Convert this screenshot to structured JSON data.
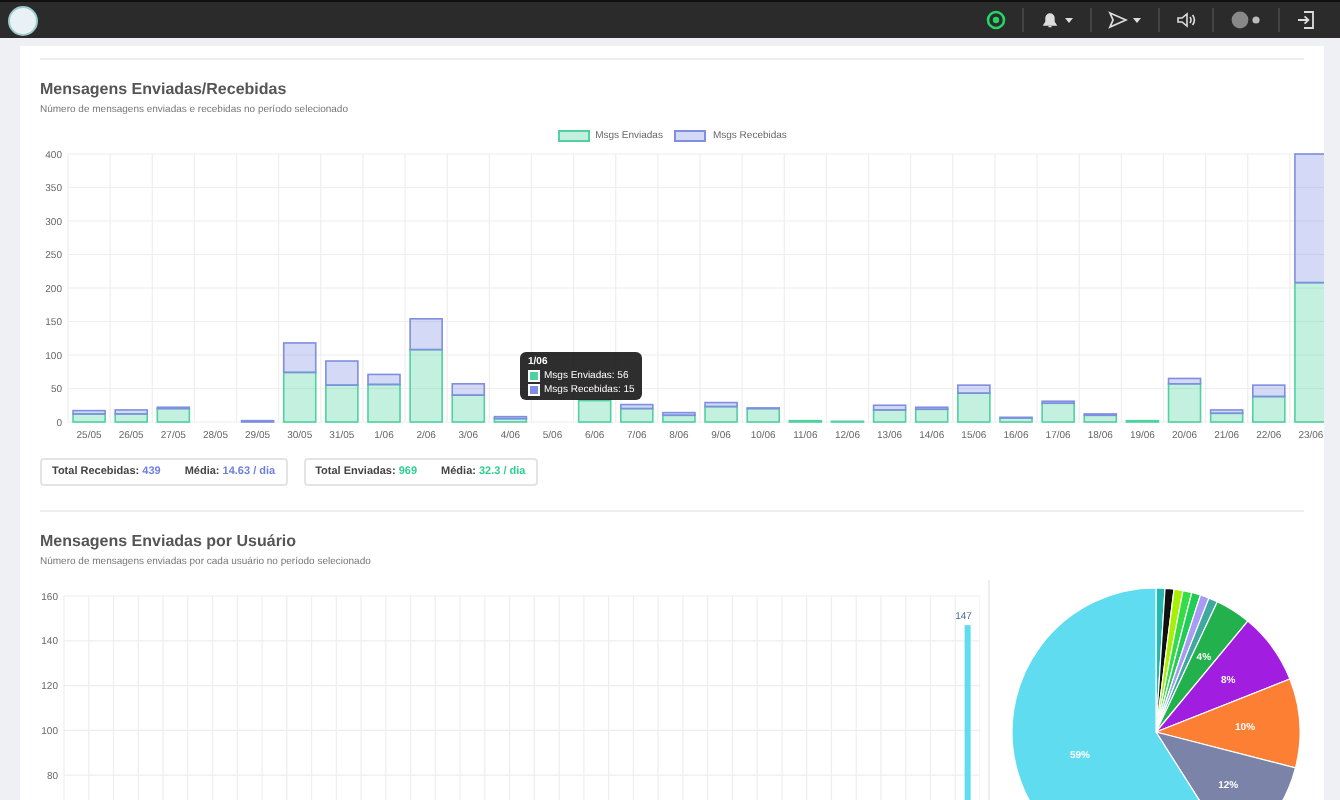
{
  "navbar": {
    "items": [
      {
        "kind": "whatsapp"
      },
      {
        "kind": "bell",
        "caret": true
      },
      {
        "kind": "send",
        "caret": true
      },
      {
        "kind": "speaker"
      },
      {
        "kind": "status"
      },
      {
        "kind": "logout"
      }
    ]
  },
  "messages_section": {
    "title": "Mensagens Enviadas/Recebidas",
    "subtitle": "Número de mensagens enviadas e recebidas no período selecionado",
    "chart_data": {
      "type": "bar",
      "stacked": true,
      "categories": [
        "25/05",
        "26/05",
        "27/05",
        "28/05",
        "29/05",
        "30/05",
        "31/05",
        "1/06",
        "2/06",
        "3/06",
        "4/06",
        "5/06",
        "6/06",
        "7/06",
        "8/06",
        "9/06",
        "10/06",
        "11/06",
        "12/06",
        "13/06",
        "14/06",
        "15/06",
        "16/06",
        "17/06",
        "18/06",
        "19/06",
        "20/06",
        "21/06",
        "22/06",
        "23/06"
      ],
      "series": [
        {
          "name": "Msgs Enviadas",
          "color": "#4fd1a0",
          "values": [
            12,
            12,
            20,
            0,
            0,
            74,
            55,
            56,
            108,
            40,
            5,
            0,
            32,
            20,
            10,
            23,
            20,
            2,
            1,
            18,
            19,
            43,
            6,
            28,
            10,
            2,
            57,
            13,
            38,
            208
          ]
        },
        {
          "name": "Msgs Recebidas",
          "color": "#7f8ee0",
          "values": [
            5,
            6,
            2,
            0,
            2,
            44,
            36,
            15,
            46,
            17,
            3,
            0,
            null,
            6,
            4,
            6,
            1,
            0,
            0,
            7,
            3,
            12,
            1,
            3,
            2,
            0,
            8,
            5,
            17,
            192
          ]
        }
      ],
      "ylim": [
        0,
        400
      ],
      "yticks": [
        0,
        50,
        100,
        150,
        200,
        250,
        300,
        350,
        400
      ],
      "grid": true
    },
    "tooltip": {
      "title": "1/06",
      "lines": [
        {
          "color": "#4fd1a0",
          "text": "Msgs Enviadas: 56"
        },
        {
          "color": "#7f8ee0",
          "text": "Msgs Recebidas: 15"
        }
      ]
    },
    "stats": [
      {
        "kind": "received",
        "label": "Total Recebidas:",
        "total": "439",
        "avg_label": "Média:",
        "avg": "14.63 / dia"
      },
      {
        "kind": "sent",
        "label": "Total Enviadas:",
        "total": "969",
        "avg_label": "Média:",
        "avg": "32.3 / dia"
      }
    ]
  },
  "users_section": {
    "title": "Mensagens Enviadas por Usuário",
    "subtitle": "Número de mensagens enviadas por cada usuário no período selecionado",
    "bar_chart": {
      "chart_data": {
        "type": "bar",
        "values": [
          null,
          null,
          null,
          null,
          null,
          null,
          null,
          null,
          null,
          null,
          null,
          null,
          null,
          null,
          null,
          null,
          null,
          null,
          null,
          null,
          null,
          null,
          null,
          null,
          null,
          null,
          null,
          null,
          null,
          null,
          null,
          null,
          null,
          null,
          null,
          null,
          147
        ],
        "yticks": [
          80,
          100,
          120,
          140,
          160
        ],
        "ylim": [
          60,
          160
        ],
        "grid": true,
        "value_labels": [
          null,
          null,
          null,
          null,
          null,
          null,
          null,
          null,
          null,
          null,
          null,
          null,
          null,
          null,
          null,
          null,
          null,
          null,
          null,
          null,
          null,
          null,
          null,
          null,
          null,
          null,
          null,
          null,
          null,
          null,
          null,
          null,
          null,
          null,
          null,
          null,
          "147"
        ],
        "color": "#5fdcef"
      }
    },
    "pie_chart": {
      "chart_data": {
        "type": "pie",
        "values": [
          1,
          1,
          1,
          1,
          1,
          1,
          1,
          4,
          8,
          10,
          12,
          59
        ],
        "colors": [
          "#25b8b0",
          "#111111",
          "#a6f000",
          "#33dd44",
          "#22cc55",
          "#a99af5",
          "#3fa8a0",
          "#22b14c",
          "#a11de0",
          "#fd7f34",
          "#7b83a8",
          "#5fdcef"
        ],
        "value_labels": [
          null,
          null,
          null,
          null,
          null,
          null,
          null,
          "4%",
          "8%",
          "10%",
          "12%",
          "59%"
        ]
      }
    }
  }
}
